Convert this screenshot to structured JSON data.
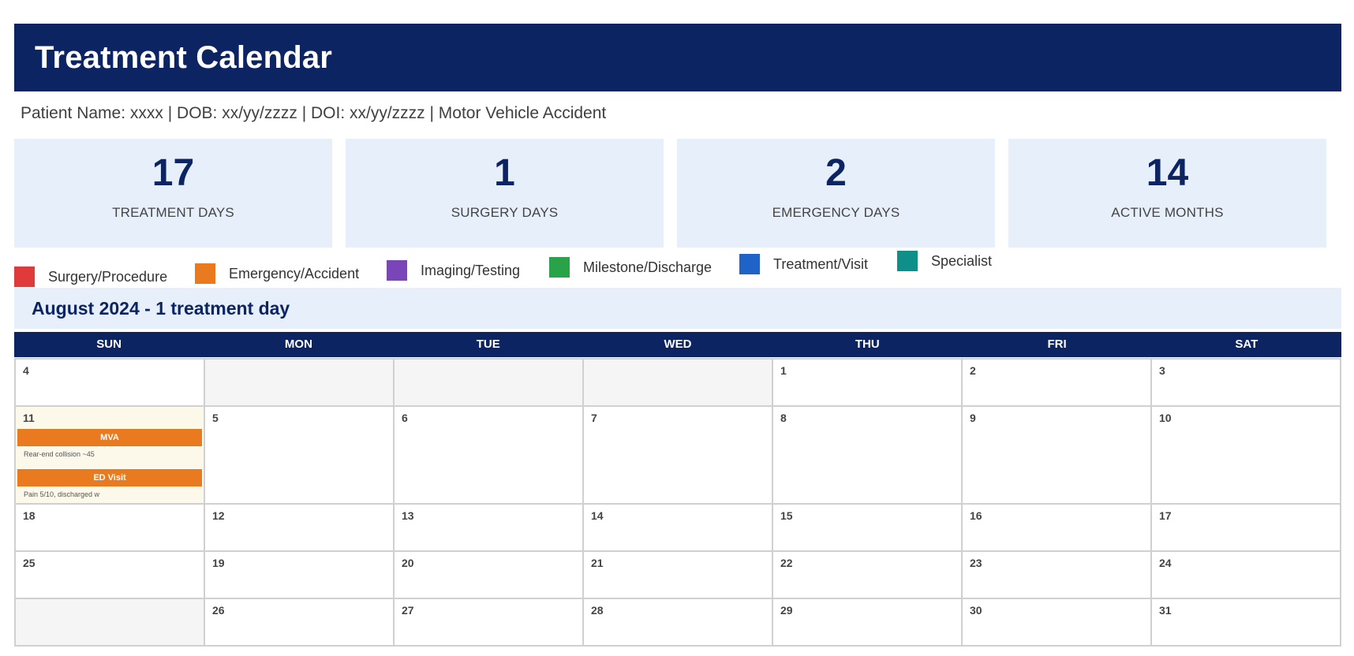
{
  "header": {
    "title": "Treatment Calendar"
  },
  "patient": {
    "line": "Patient Name: xxxx | DOB: xx/yy/zzzz | DOI: xx/yy/zzzz | Motor Vehicle Accident"
  },
  "stats": [
    {
      "value": "17",
      "label": "TREATMENT DAYS"
    },
    {
      "value": "1",
      "label": "SURGERY DAYS"
    },
    {
      "value": "2",
      "label": "EMERGENCY DAYS"
    },
    {
      "value": "14",
      "label": "ACTIVE MONTHS"
    }
  ],
  "legend": [
    {
      "label": "Surgery/Procedure",
      "color": "#e03a3a"
    },
    {
      "label": "Emergency/Accident",
      "color": "#ea7a20"
    },
    {
      "label": "Imaging/Testing",
      "color": "#7a45b8"
    },
    {
      "label": "Milestone/Discharge",
      "color": "#2aa24a"
    },
    {
      "label": "Treatment/Visit",
      "color": "#1f63c9"
    },
    {
      "label": "Specialist",
      "color": "#0e8f8a"
    }
  ],
  "month": {
    "title": "August 2024 - 1 treatment day"
  },
  "weekdays": [
    "SUN",
    "MON",
    "TUE",
    "WED",
    "THU",
    "FRI",
    "SAT"
  ],
  "calendar": {
    "weeks": [
      [
        {
          "day": "4"
        },
        {
          "day": ""
        },
        {
          "day": ""
        },
        {
          "day": ""
        },
        {
          "day": "1"
        },
        {
          "day": "2"
        },
        {
          "day": "3"
        }
      ],
      [
        {
          "day": "11"
        },
        {
          "day": "5"
        },
        {
          "day": "6"
        },
        {
          "day": "7"
        },
        {
          "day": "8"
        },
        {
          "day": "9"
        },
        {
          "day": "10"
        }
      ],
      [
        {
          "day": "18"
        },
        {
          "day": "12"
        },
        {
          "day": "13"
        },
        {
          "day": "14"
        },
        {
          "day": "15"
        },
        {
          "day": "16"
        },
        {
          "day": "17"
        }
      ],
      [
        {
          "day": "25"
        },
        {
          "day": "19"
        },
        {
          "day": "20"
        },
        {
          "day": "21"
        },
        {
          "day": "22"
        },
        {
          "day": "23"
        },
        {
          "day": "24"
        }
      ],
      [
        {
          "day": ""
        },
        {
          "day": "26"
        },
        {
          "day": "27"
        },
        {
          "day": "28"
        },
        {
          "day": "29"
        },
        {
          "day": "30"
        },
        {
          "day": "31"
        }
      ]
    ],
    "events_day11": [
      {
        "label": "MVA",
        "note": "Rear-end collision ~45",
        "color": "#ea7a20"
      },
      {
        "label": "ED Visit",
        "note": "Pain 5/10, discharged w",
        "color": "#ea7a20"
      }
    ]
  },
  "colors": {
    "navy": "#0d2463",
    "light_panel": "#e6effa",
    "highlight_cell": "#fdf9ea",
    "empty_cell": "#f5f5f5"
  }
}
